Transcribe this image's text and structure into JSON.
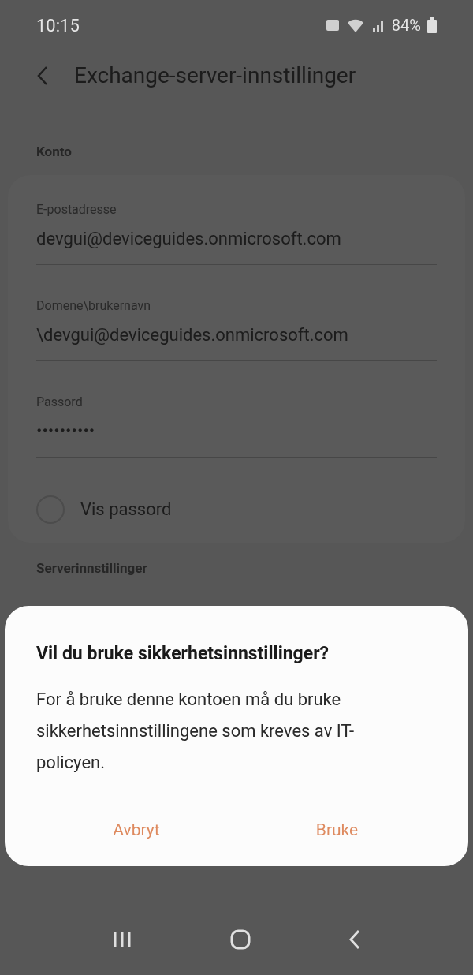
{
  "status_bar": {
    "time": "10:15",
    "battery": "84%"
  },
  "header": {
    "title": "Exchange-server-innstillinger"
  },
  "sections": [
    {
      "title": "Konto",
      "fields": [
        {
          "label": "E-postadresse",
          "value": "devgui@deviceguides.onmicrosoft.com"
        },
        {
          "label": "Domene\\brukernavn",
          "value": "\\devgui@deviceguides.onmicrosoft.com"
        },
        {
          "label": "Passord",
          "value": "••••••••••"
        }
      ],
      "checkbox": {
        "label": "Vis passord",
        "checked": false
      }
    },
    {
      "title": "Serverinnstillinger"
    }
  ],
  "dialog": {
    "title": "Vil du bruke sikkerhetsinnstillinger?",
    "body": "For å bruke denne kontoen må du bruke sikkerhetsinnstillingene som kreves av IT-policyen.",
    "buttons": [
      "Avbryt",
      "Bruke"
    ]
  }
}
